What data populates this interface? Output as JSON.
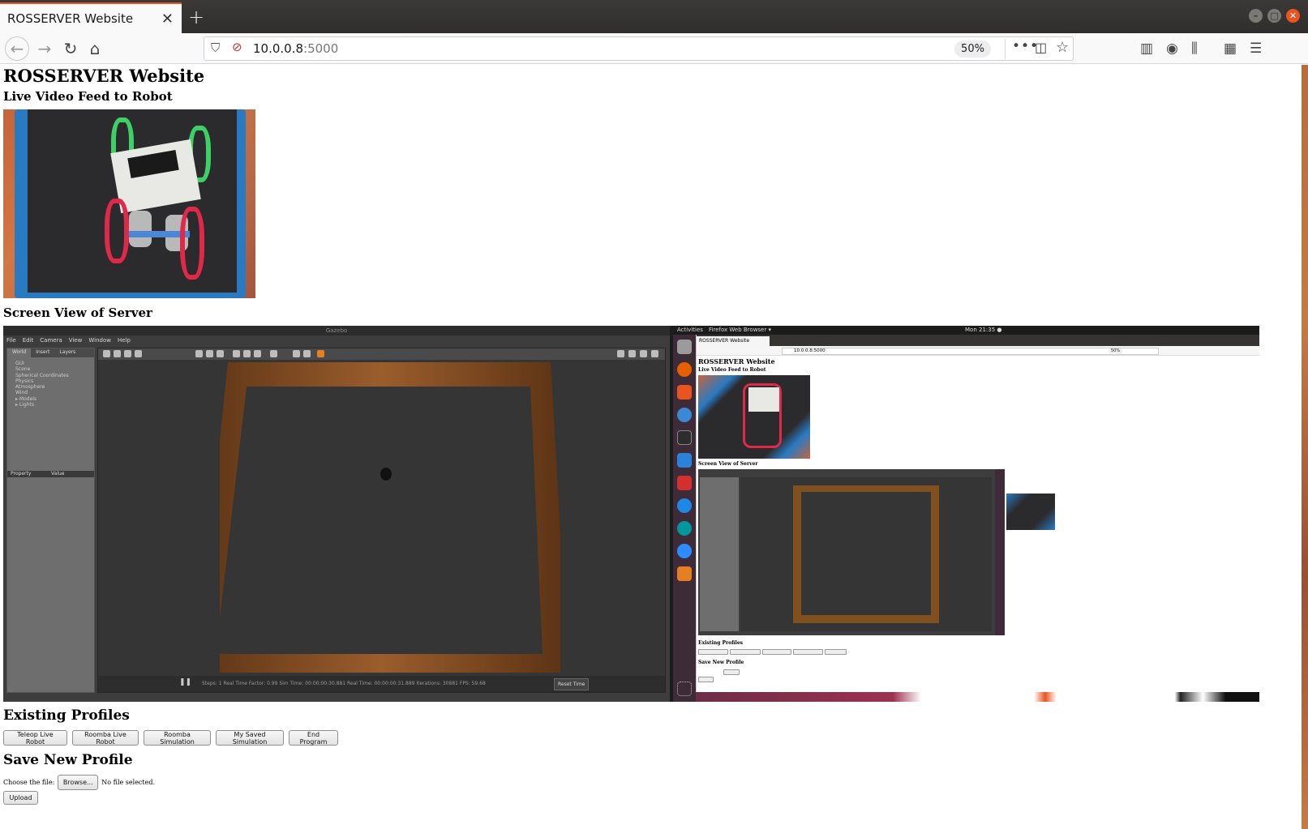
{
  "browser": {
    "tab_title": "ROSSERVER Website",
    "tab_close": "✕",
    "new_tab": "+",
    "url_host": "10.0.0.8",
    "url_port": ":5000",
    "zoom": "50%",
    "more": "•••"
  },
  "page": {
    "title": "ROSSERVER Website",
    "live_feed_heading": "Live Video Feed to Robot",
    "screen_heading": "Screen View of Server",
    "existing_profiles_heading": "Existing Profiles",
    "profiles": [
      "Teleop Live Robot",
      "Roomba Live Robot",
      "Roomba Simulation",
      "My Saved Simulation",
      "End Program"
    ],
    "save_heading": "Save New Profile",
    "choose_label": "Choose the file:",
    "browse_label": "Browse...",
    "no_file": "No file selected.",
    "upload_label": "Upload"
  },
  "gazebo": {
    "window_title": "Gazebo",
    "menu": [
      "File",
      "Edit",
      "Camera",
      "View",
      "Window",
      "Help"
    ],
    "tabs": [
      "World",
      "Insert",
      "Layers"
    ],
    "tree": [
      "GUI",
      "Scene",
      "Spherical Coordinates",
      "Physics",
      "Atmosphere",
      "Wind",
      "▸ Models",
      "▸ Lights"
    ],
    "prop_header": [
      "Property",
      "Value"
    ],
    "status": "Steps: 1  Real Time Factor: 0.99   Sim Time: 00:00:00:30.881   Real Time: 00:00:00:31.889   Iterations: 30881   FPS: 59.68",
    "reset": "Reset Time"
  },
  "ubuntu": {
    "activities": "Activities",
    "app": "Firefox Web Browser ▾",
    "clock": "Mon 21:35 ●",
    "mini_title": "ROSSERVER Website",
    "mini_feed": "Live Video Feed to Robot",
    "mini_screen": "Screen View of Server",
    "mini_profiles": "Existing Profiles",
    "mini_save": "Save New Profile",
    "mini_url": "10.0.0.8:5000",
    "mini_tab": "ROSSERVER Website",
    "mini_zoom": "50%"
  }
}
